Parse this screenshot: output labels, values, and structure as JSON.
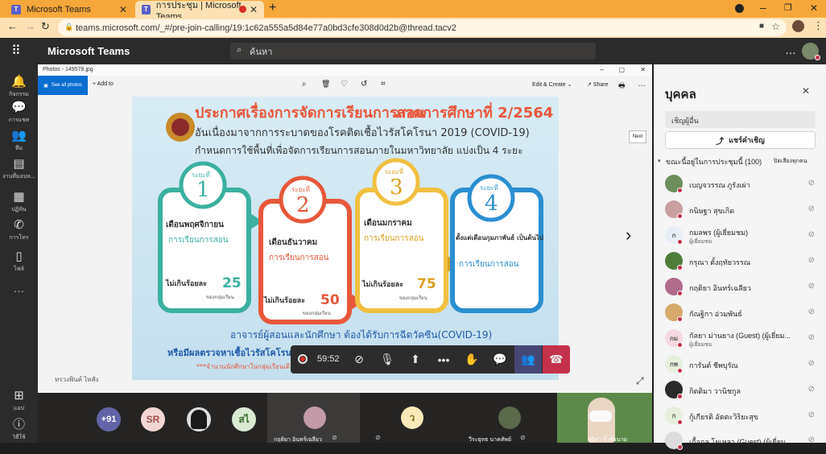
{
  "browser": {
    "tabs": [
      {
        "label": "Microsoft Teams"
      },
      {
        "label": "การประชุม | Microsoft Teams"
      }
    ],
    "url": "teams.microsoft.com/_#/pre-join-calling/19:1c62a555a5d84e77a0bd3cfe308d0d2b@thread.tacv2"
  },
  "teams": {
    "app_title": "Microsoft Teams",
    "search_placeholder": "ค้นหา"
  },
  "rail": [
    {
      "label": "กิจกรรม",
      "icon": "bell-icon"
    },
    {
      "label": "การแชท",
      "icon": "chat-icon"
    },
    {
      "label": "ทีม",
      "icon": "teams-icon"
    },
    {
      "label": "งานที่มอบห...",
      "icon": "assignments-icon"
    },
    {
      "label": "ปฏิทิน",
      "icon": "calendar-icon"
    },
    {
      "label": "การโทร",
      "icon": "phone-icon"
    },
    {
      "label": "ไฟล์",
      "icon": "files-icon"
    },
    {
      "label": "แอป",
      "icon": "apps-icon"
    },
    {
      "label": "วิธีใช้",
      "icon": "help-icon"
    }
  ],
  "photos": {
    "title": "Photos - 149578.jpg",
    "see_all": "See all photos",
    "add_to": "Add to",
    "edit_create": "Edit & Create",
    "share": "Share",
    "next": "Next"
  },
  "poster": {
    "title_a": "ประกาศเรื่องการจัดการเรียนการสอน",
    "title_b": "ภาคการศึกษาที่ 2/2564",
    "line1": "อันเนื่องมาจากการระบาดของโรคติดเชื้อไวรัสโคโรนา 2019 (COVID-19)",
    "line2": "กำหนดการใช้พื้นที่เพื่อจัดการเรียนการสอนภายในมหาวิทยาลัย แบ่งเป็น 4 ระยะ",
    "phases": [
      {
        "tag": "ระยะที่",
        "num": "1",
        "month": "เดือนพฤศจิกายน",
        "mode": "การเรียนการสอน",
        "limit_label": "ไม่เกินร้อยละ",
        "limit": "25",
        "unit": "ของกลุ่มเรียน"
      },
      {
        "tag": "ระยะที่",
        "num": "2",
        "month": "เดือนธันวาคม",
        "mode": "การเรียนการสอน",
        "limit_label": "ไม่เกินร้อยละ",
        "limit": "50",
        "unit": "ของกลุ่มเรียน"
      },
      {
        "tag": "ระยะที่",
        "num": "3",
        "month": "เดือนมกราคม",
        "mode": "การเรียนการสอน",
        "limit_label": "ไม่เกินร้อยละ",
        "limit": "75",
        "unit": "ของกลุ่มเรียน"
      },
      {
        "tag": "ระยะที่",
        "num": "4",
        "month": "ตั้งแต่เดือนกุมภาพันธ์ เป็นต้นไป",
        "mode": "การเรียนการสอน",
        "limit_label": "",
        "limit": "",
        "unit": ""
      }
    ],
    "footer1": "อาจารย์ผู้สอนและนักศึกษา ต้องได้รับการฉีดวัคซีน(COVID-19)",
    "footer2": "หรือมีผลตรวจหาเชื้อไวรัสโคโรนา",
    "footer3": "***จำนวนนักศึกษาในกลุ่มเรียนเดียวกัน",
    "caption": "ทรวงพินค์ ไทสัง"
  },
  "controls": {
    "timer": "59:52"
  },
  "strip": {
    "overflow_count": "+91",
    "initials_sr": "SR",
    "initials_a": "สไ",
    "initials_w": "ว",
    "participant1": "กฤติยา อินทร์เฉลียว",
    "participant2": "วีระยุทธ นาคทัพย์",
    "participant3": "สุธิดา จิ๋วทัยนาม"
  },
  "panel": {
    "title": "บุคคล",
    "invite_placeholder": "เชิญผู้อื่น",
    "share_invite": "แชร์คำเชิญ",
    "section": "ขณะนี้อยู่ในการประชุมนี้ (100)",
    "mute_all": "ปิดเสียงทุกคน",
    "people": [
      {
        "name": "เบญจวรรณ ภูรังเผ่า",
        "sub": "",
        "initials": "",
        "color": "#6b8e5a"
      },
      {
        "name": "กนิษฐา สุขเกิด",
        "sub": "",
        "initials": "",
        "color": "#c9a0a0"
      },
      {
        "name": "กมลพร (ผู้เยี่ยมชม)",
        "sub": "ผู้เยี่ยมชม",
        "initials": "ก",
        "color": "#e8eef7"
      },
      {
        "name": "กรุณา ตั้งฤทัยวรรณ",
        "sub": "",
        "initials": "",
        "color": "#4e7d3a"
      },
      {
        "name": "กฤติยา อินทร์เฉลียว",
        "sub": "",
        "initials": "",
        "color": "#b06a8a"
      },
      {
        "name": "กัณฐิกา อ่วมพันธ์",
        "sub": "",
        "initials": "",
        "color": "#d6a86a"
      },
      {
        "name": "กัลยา ม่านยาง (Guest) (ผู้เยี่ยม...",
        "sub": "ผู้เยี่ยมชม",
        "initials": "กม",
        "color": "#f6d8e0"
      },
      {
        "name": "การันต์ ชีพบุรัณ",
        "sub": "",
        "initials": "กพ",
        "color": "#e6f0dc"
      },
      {
        "name": "กิตติมา วานิชกูล",
        "sub": "",
        "initials": "",
        "color": "#2a2a2a"
      },
      {
        "name": "กู้เกียรติ อัตตะวิริยะสุข",
        "sub": "",
        "initials": "ก",
        "color": "#e6f0dc"
      },
      {
        "name": "เกื้อกูล โยเหลา (Guest) (ผู้เยี่ยม...",
        "sub": "",
        "initials": "",
        "color": "#dcdcdc"
      }
    ]
  },
  "colors": {
    "browser_bar": "#f6a73a",
    "teams_dark": "#2b2b2b",
    "accent": "#6264a7",
    "hangup": "#c4314b"
  }
}
